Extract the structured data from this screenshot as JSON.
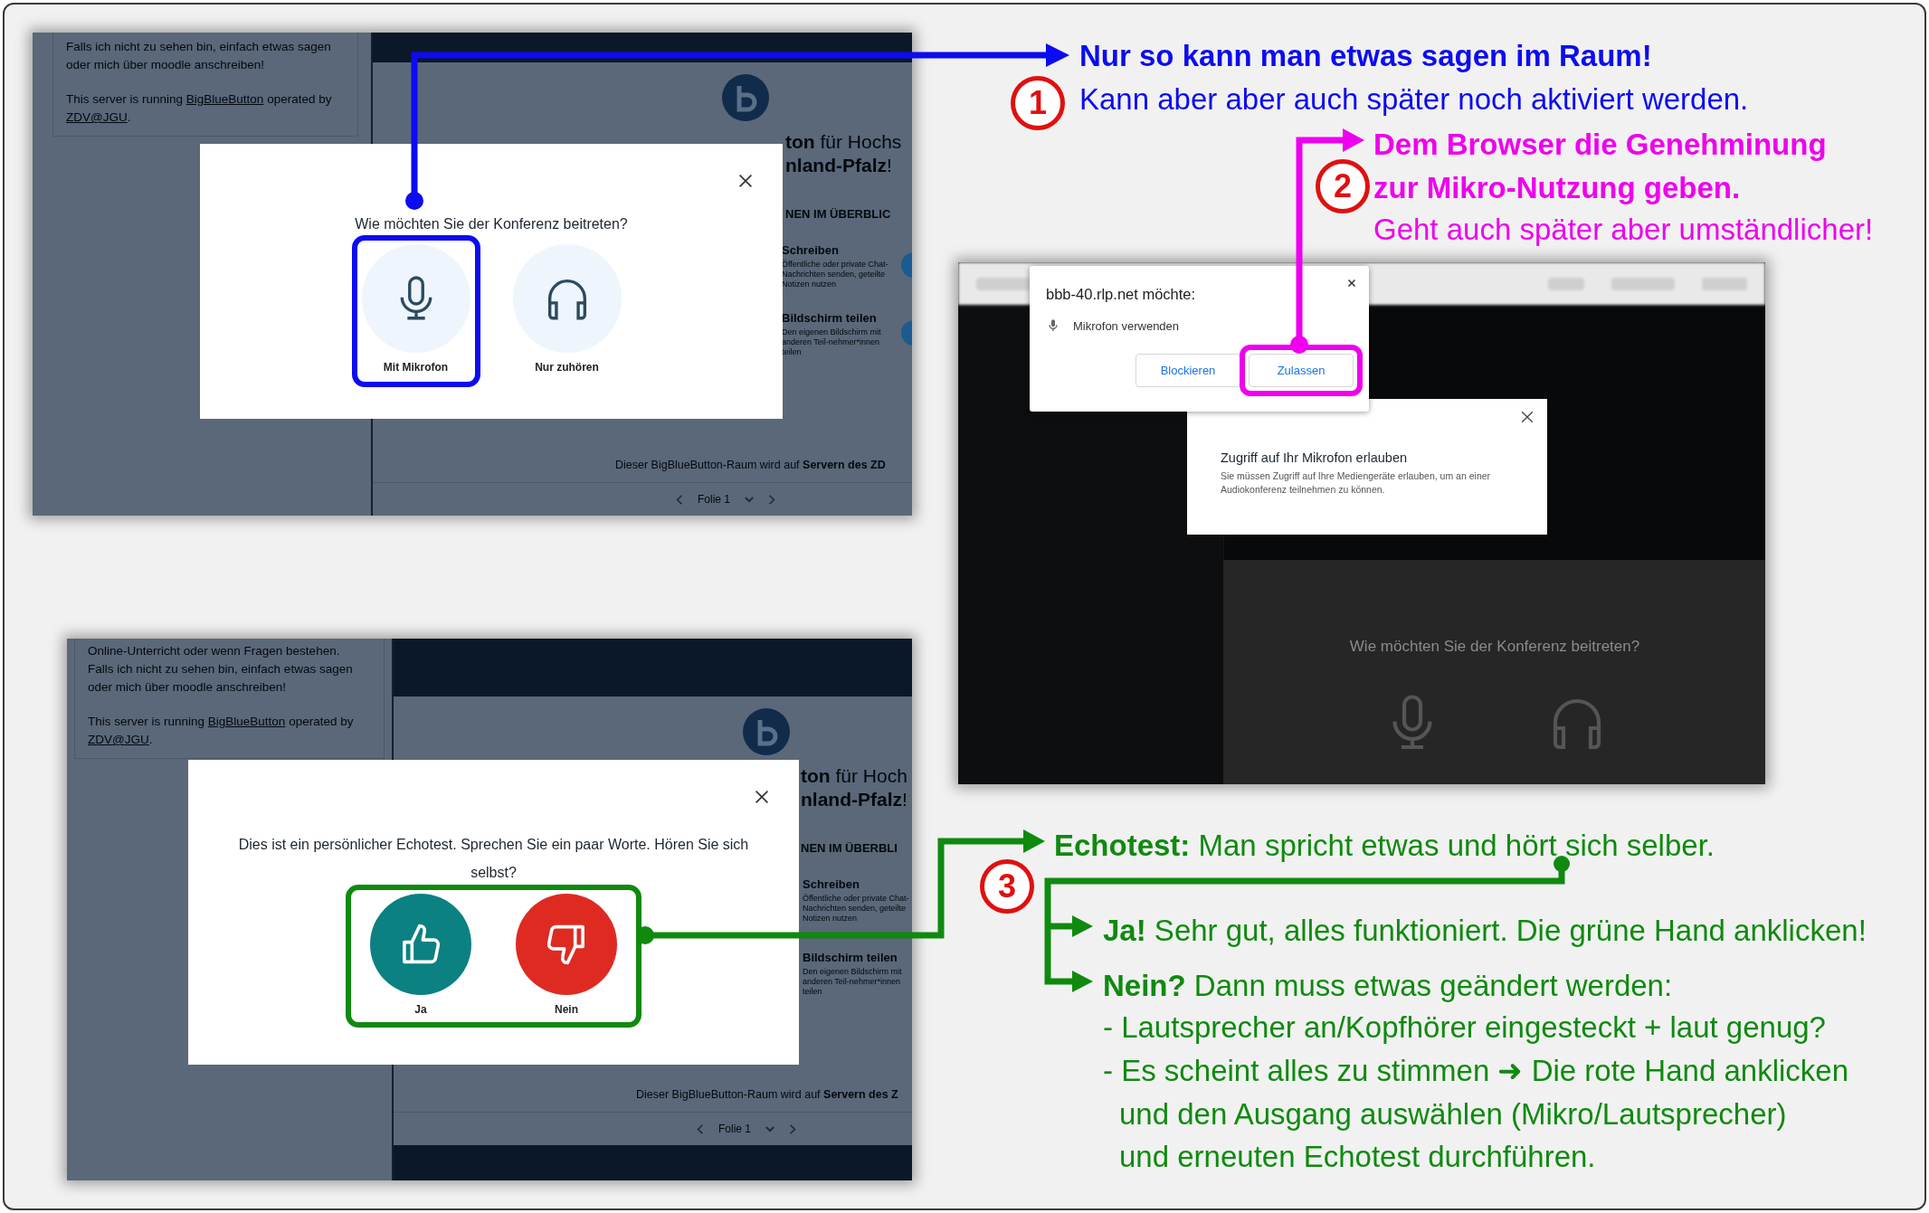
{
  "join_screen": {
    "sidebar": {
      "paragraphs": [
        "Falls ich nicht zu sehen bin, einfach etwas sagen oder mich über moodle anschreiben!"
      ],
      "server_note": [
        {
          "text": "This server is running ",
          "link": false
        },
        {
          "text": "BigBlueButton",
          "link": true
        },
        {
          "text": " operated by ",
          "link": false
        },
        {
          "text": "ZDV@JGU",
          "link": true
        },
        {
          "text": ".",
          "link": false
        }
      ]
    },
    "presentation": {
      "heading": [
        "**ton** für Hochs",
        "**nland-Pfalz**!"
      ],
      "section_title": "NEN IM ÜBERBLIC",
      "features": [
        {
          "title": "Schreiben",
          "description": "Öffentliche oder private Chat-Nachrichten senden, geteilte Notizen nutzen"
        },
        {
          "title": "Bildschirm teilen",
          "description": "Den eigenen Bildschirm mit anderen Teil-nehmer*innen teilen"
        }
      ],
      "footer": "Dieser BigBlueButton-Raum wird auf **Servern des ZD**",
      "slide_label": "Folie 1"
    },
    "dialog": {
      "kind": "audio_join",
      "question": "Wie möchten Sie der Konferenz beitreten?",
      "options": [
        {
          "kind": "microphone",
          "label": "Mit Mikrofon",
          "highlighted": true
        },
        {
          "kind": "headphones",
          "label": "Nur zuhören",
          "highlighted": false
        }
      ]
    }
  },
  "permission_screen": {
    "browser_prompt": {
      "title": "bbb-40.rlp.net möchte:",
      "permission": "Mikrofon verwenden",
      "buttons": [
        {
          "label": "Blockieren",
          "highlighted": false
        },
        {
          "label": "Zulassen",
          "highlighted": true
        }
      ]
    },
    "notice": {
      "title": "Zugriff auf Ihr Mikrofon erlauben",
      "text": "Sie müssen Zugriff auf Ihre Mediengeräte erlauben, um an einer Audiokonferenz teilnehmen zu können."
    },
    "background_dialog": {
      "question": "Wie möchten Sie der Konferenz beitreten?"
    }
  },
  "echo_test_screen": {
    "sidebar": {
      "paragraphs": [
        "Online-Unterricht oder wenn Fragen bestehen.",
        "Falls ich nicht zu sehen bin, einfach etwas sagen oder mich über moodle anschreiben!"
      ],
      "server_note": [
        {
          "text": "This server is running ",
          "link": false
        },
        {
          "text": "BigBlueButton",
          "link": true
        },
        {
          "text": " operated by ",
          "link": false
        },
        {
          "text": "ZDV@JGU",
          "link": true
        },
        {
          "text": ".",
          "link": false
        }
      ]
    },
    "presentation": {
      "heading": [
        "**ton** für Hoch",
        "**nland-Pfalz**!"
      ],
      "section_title": "NEN IM ÜBERBLI",
      "features": [
        {
          "title": "Schreiben",
          "description": "Öffentliche oder private Chat-Nachrichten senden, geteilte Notizen nutzen"
        },
        {
          "title": "Bildschirm teilen",
          "description": "Den eigenen Bildschirm mit anderen Teil-nehmer*innen teilen"
        }
      ],
      "footer": "Dieser BigBlueButton-Raum wird auf **Servern des Z**",
      "slide_label": "Folie 1"
    },
    "dialog": {
      "kind": "echo_test",
      "question": "Dies ist ein persönlicher Echotest. Sprechen Sie ein paar Worte. Hören Sie sich selbst?",
      "buttons_highlighted": true,
      "options": [
        {
          "kind": "thumbs_up",
          "label": "Ja"
        },
        {
          "kind": "thumbs_down",
          "label": "Nein"
        }
      ]
    }
  },
  "callouts": [
    {
      "number": "1",
      "color": "#0c0cf0",
      "lines": [
        {
          "kind": "heading",
          "text": "Nur so kann man etwas sagen im Raum!"
        },
        {
          "kind": "body",
          "text": "Kann aber aber auch später noch aktiviert werden."
        }
      ]
    },
    {
      "number": "2",
      "color": "#ee00ee",
      "lines": [
        {
          "kind": "heading",
          "text": "Dem Browser die Genehminung"
        },
        {
          "kind": "heading",
          "text": "zur Mikro-Nutzung geben."
        },
        {
          "kind": "body",
          "text": "Geht auch später aber umständlicher!"
        }
      ]
    },
    {
      "number": "3",
      "color": "#0f8a0f",
      "lines": [
        {
          "kind": "lead",
          "text": "**Echotest:** Man spricht etwas und hört sich selber."
        },
        {
          "kind": "answer",
          "text": "**Ja!** Sehr gut, alles funktioniert. Die grüne Hand anklicken!"
        },
        {
          "kind": "answer",
          "text": "**Nein?** Dann muss etwas geändert werden:"
        },
        {
          "kind": "bullet",
          "text": "- Lautsprecher an/Kopfhörer eingesteckt + laut genug?"
        },
        {
          "kind": "bullet",
          "text": "- Es scheint alles zu stimmen ➜ Die rote Hand anklicken"
        },
        {
          "kind": "continuation",
          "text": "und den Ausgang auswählen (Mikro/Lautsprecher)"
        },
        {
          "kind": "continuation",
          "text": "und erneuten Echotest durchführen."
        }
      ]
    }
  ]
}
